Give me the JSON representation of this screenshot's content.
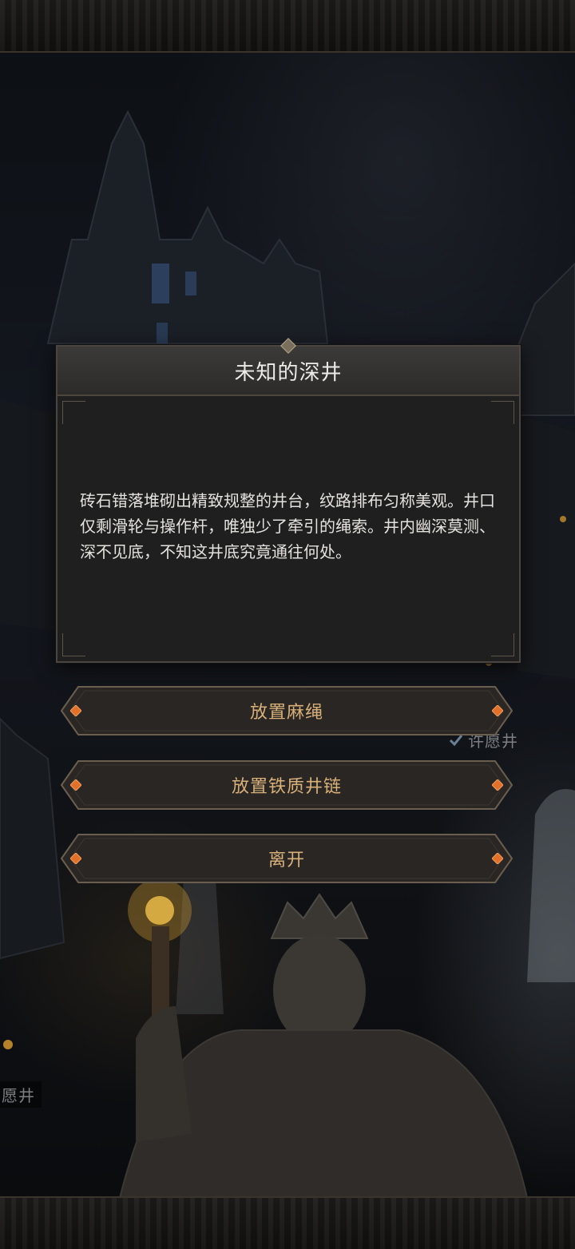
{
  "dialog": {
    "title": "未知的深井",
    "description": "砖石错落堆砌出精致规整的井台，纹路排布匀称美观。井口仅剩滑轮与操作杆，唯独少了牵引的绳索。井内幽深莫测、深不见底，不知这井底究竟通往何处。"
  },
  "options": [
    {
      "label": "放置麻绳"
    },
    {
      "label": "放置铁质井链"
    },
    {
      "label": "离开"
    }
  ],
  "map_labels": {
    "right": "许愿井",
    "left": "愿井"
  },
  "colors": {
    "option_text": "#d8b07a",
    "gem_accent": "#e0702a",
    "dialog_bg": "#1f1f1f"
  }
}
